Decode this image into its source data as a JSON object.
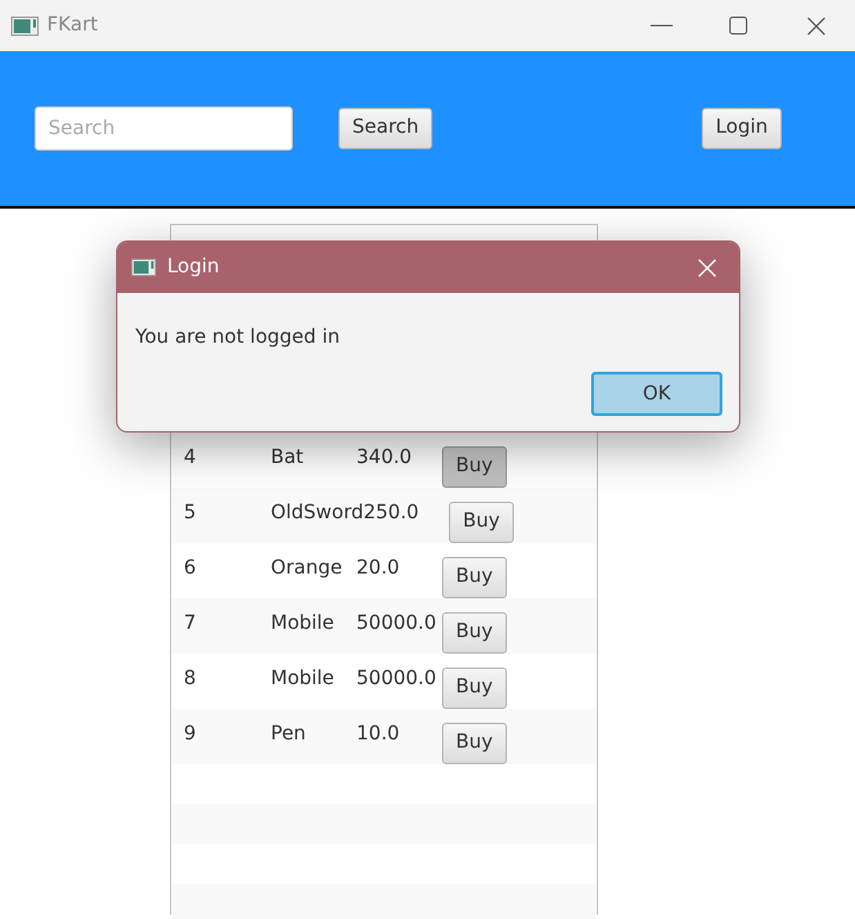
{
  "window": {
    "title": "FKart"
  },
  "header": {
    "search": {
      "placeholder": "Search"
    },
    "search_button": "Search",
    "login_button": "Login"
  },
  "products": [
    {
      "id": "4",
      "name": "Bat",
      "price": "340.0",
      "button": "Buy",
      "pressed": true
    },
    {
      "id": "5",
      "name": "OldSword",
      "price": "250.0",
      "button": "Buy",
      "pressed": false
    },
    {
      "id": "6",
      "name": "Orange",
      "price": "20.0",
      "button": "Buy",
      "pressed": false
    },
    {
      "id": "7",
      "name": "Mobile",
      "price": "50000.0",
      "button": "Buy",
      "pressed": false
    },
    {
      "id": "8",
      "name": "Mobile",
      "price": "50000.0",
      "button": "Buy",
      "pressed": false
    },
    {
      "id": "9",
      "name": "Pen",
      "price": "10.0",
      "button": "Buy",
      "pressed": false
    }
  ],
  "dialog": {
    "title": "Login",
    "message": "You are not logged in",
    "ok_button": "OK"
  }
}
